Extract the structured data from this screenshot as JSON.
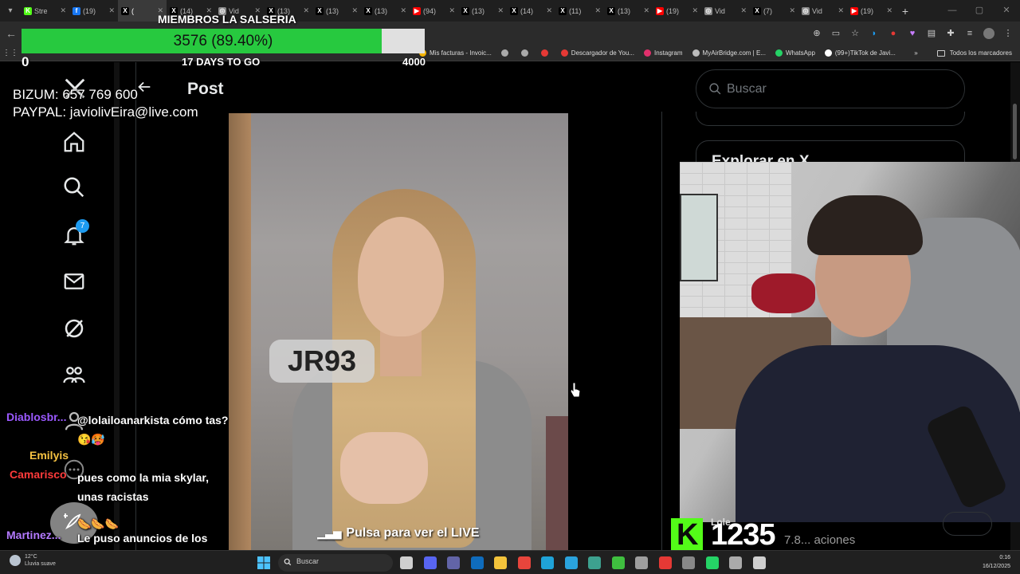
{
  "browser": {
    "tabs": [
      {
        "label": "Stre",
        "icon": "kick-icon",
        "color": "#53fc18",
        "glyph": "K"
      },
      {
        "label": "(19)",
        "icon": "facebook-icon",
        "color": "#1877f2",
        "glyph": "f"
      },
      {
        "label": "(",
        "icon": "x-icon",
        "color": "#000000",
        "glyph": "X",
        "active": true
      },
      {
        "label": "(14)",
        "icon": "x-icon",
        "color": "#000000",
        "glyph": "X"
      },
      {
        "label": "Vid",
        "icon": "globe-icon",
        "color": "#888888",
        "glyph": "◎"
      },
      {
        "label": "(13)",
        "icon": "x-icon",
        "color": "#000000",
        "glyph": "X"
      },
      {
        "label": "(13)",
        "icon": "x-icon",
        "color": "#000000",
        "glyph": "X"
      },
      {
        "label": "(13)",
        "icon": "x-icon",
        "color": "#000000",
        "glyph": "X"
      },
      {
        "label": "(94)",
        "icon": "youtube-icon",
        "color": "#ff0000",
        "glyph": "▶"
      },
      {
        "label": "(13)",
        "icon": "x-icon",
        "color": "#000000",
        "glyph": "X"
      },
      {
        "label": "(14)",
        "icon": "x-icon",
        "color": "#000000",
        "glyph": "X"
      },
      {
        "label": "(11)",
        "icon": "x-icon",
        "color": "#000000",
        "glyph": "X"
      },
      {
        "label": "(13)",
        "icon": "x-icon",
        "color": "#000000",
        "glyph": "X"
      },
      {
        "label": "(19)",
        "icon": "youtube-icon",
        "color": "#ff0000",
        "glyph": "▶"
      },
      {
        "label": "Vid",
        "icon": "globe-icon",
        "color": "#888888",
        "glyph": "◎"
      },
      {
        "label": "(7)",
        "icon": "x-icon",
        "color": "#000000",
        "glyph": "X"
      },
      {
        "label": "Vid",
        "icon": "globe-icon",
        "color": "#888888",
        "glyph": "◎"
      },
      {
        "label": "(19)",
        "icon": "youtube-icon",
        "color": "#ff0000",
        "glyph": "▶"
      }
    ],
    "bookmarks": [
      {
        "label": "Mis facturas - Invoic...",
        "color": "#f4b400"
      },
      {
        "label": "",
        "color": "#aaaaaa"
      },
      {
        "label": "",
        "color": "#aaaaaa"
      },
      {
        "label": "",
        "color": "#e53935"
      },
      {
        "label": "Descargador de You...",
        "color": "#e53935"
      },
      {
        "label": "Instagram",
        "color": "#e1306c"
      },
      {
        "label": "MyAirBridge.com | E...",
        "color": "#bbbbbb"
      },
      {
        "label": "WhatsApp",
        "color": "#25d366"
      },
      {
        "label": "(99+)TikTok de Javi...",
        "color": "#ffffff"
      }
    ],
    "all_bookmarks": "Todos los marcadores"
  },
  "goal": {
    "title": "MIEMBROS LA SALSERIA",
    "current": 3576,
    "target": 4000,
    "progress_fraction": 0.894,
    "label": "3576 (89.40%)",
    "min_label": "0",
    "max_label": "4000",
    "days_left": "17 DAYS TO GO",
    "fill_color": "#27c93f"
  },
  "donation": {
    "bizum": "BIZUM: 657 769 600",
    "paypal": "PAYPAL: javiolivEira@live.com"
  },
  "x": {
    "notifications_count": "7",
    "post_title": "Post",
    "search_placeholder": "Buscar",
    "trending_title": "Explorar en X",
    "accent": "#1d9bf0"
  },
  "video": {
    "overlay_label": "JR93",
    "cta": "Pulsa para ver el LIVE"
  },
  "chat": [
    {
      "user": "Diablosbr...",
      "color": "#9b59ff",
      "text": "@lolailoanarkista cómo tas?😘🥵"
    },
    {
      "user": "Emilyis",
      "color": "#f5c242",
      "text": ""
    },
    {
      "user": "Camarisco",
      "color": "#ff3b3b",
      "text": "pues como la mia skylar, unas racistas"
    },
    {
      "user": "",
      "color": "#ffffff",
      "text": "🌭🌭🌭"
    },
    {
      "user": "Martinez...",
      "color": "#b47aff",
      "text": "Le puso anuncios de los conguitos también?"
    }
  ],
  "stream": {
    "viewer_count": "1235",
    "kick_letter": "K",
    "kick_color": "#53fc18",
    "under_text": "7.8... aciones",
    "over_text": "Lole"
  },
  "taskbar": {
    "weather_temp": "12°C",
    "weather_desc": "Lluvia suave",
    "search": "Buscar",
    "time": "0:16",
    "date": "16/12/2025",
    "apps": [
      {
        "icon": "task-view-icon",
        "color": "#cfcfcf"
      },
      {
        "icon": "discord-icon",
        "color": "#5865f2"
      },
      {
        "icon": "teams-icon",
        "color": "#6264a7"
      },
      {
        "icon": "outlook-icon",
        "color": "#0f6cbd"
      },
      {
        "icon": "file-explorer-icon",
        "color": "#f3c33b"
      },
      {
        "icon": "chrome-icon",
        "color": "#e8453c"
      },
      {
        "icon": "edge-icon",
        "color": "#1fa3d8"
      },
      {
        "icon": "telegram-icon",
        "color": "#2aa3dd"
      },
      {
        "icon": "network-icon",
        "color": "#3da18f"
      },
      {
        "icon": "green-app-icon",
        "color": "#3fbf3f"
      },
      {
        "icon": "obs-icon",
        "color": "#9e9e9e"
      },
      {
        "icon": "ball-icon",
        "color": "#e53935"
      },
      {
        "icon": "settings-icon",
        "color": "#888888"
      },
      {
        "icon": "whatsapp-icon",
        "color": "#25d366"
      },
      {
        "icon": "capture-icon",
        "color": "#aaaaaa"
      },
      {
        "icon": "notepad-icon",
        "color": "#cfcfcf"
      }
    ]
  }
}
